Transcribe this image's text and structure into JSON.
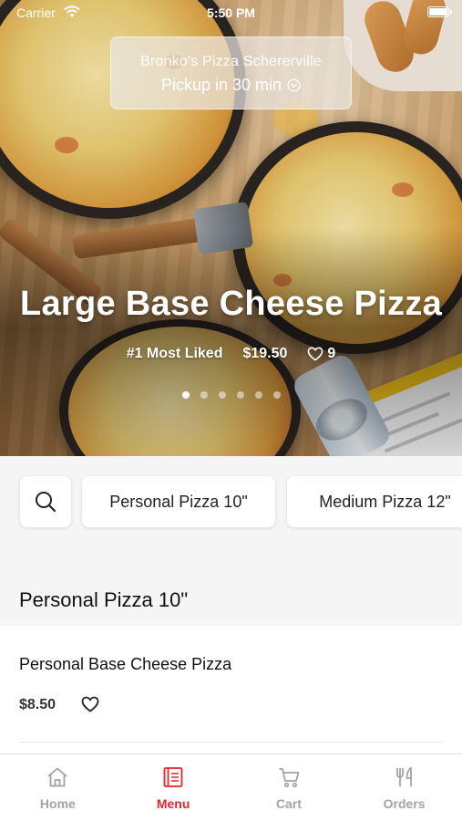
{
  "status_bar": {
    "carrier": "Carrier",
    "time": "5:50 PM"
  },
  "store": {
    "name": "Bronko's Pizza Schererville",
    "pickup": "Pickup in 30 min"
  },
  "featured": {
    "title": "Large Base Cheese Pizza",
    "badge": "#1 Most Liked",
    "price": "$19.50",
    "likes": "9",
    "pages": 6,
    "active_page": 1
  },
  "categories": [
    "Personal Pizza 10\"",
    "Medium Pizza 12\""
  ],
  "section": {
    "title": "Personal Pizza 10\""
  },
  "items": [
    {
      "name": "Personal Base Cheese Pizza",
      "price": "$8.50"
    }
  ],
  "tabs": [
    {
      "label": "Home",
      "icon": "home-icon",
      "active": false
    },
    {
      "label": "Menu",
      "icon": "menu-icon",
      "active": true
    },
    {
      "label": "Cart",
      "icon": "cart-icon",
      "active": false
    },
    {
      "label": "Orders",
      "icon": "orders-icon",
      "active": false
    }
  ],
  "colors": {
    "accent": "#e0262c",
    "inactive_tab": "#a3a3a3",
    "background": "#f5f5f5"
  }
}
